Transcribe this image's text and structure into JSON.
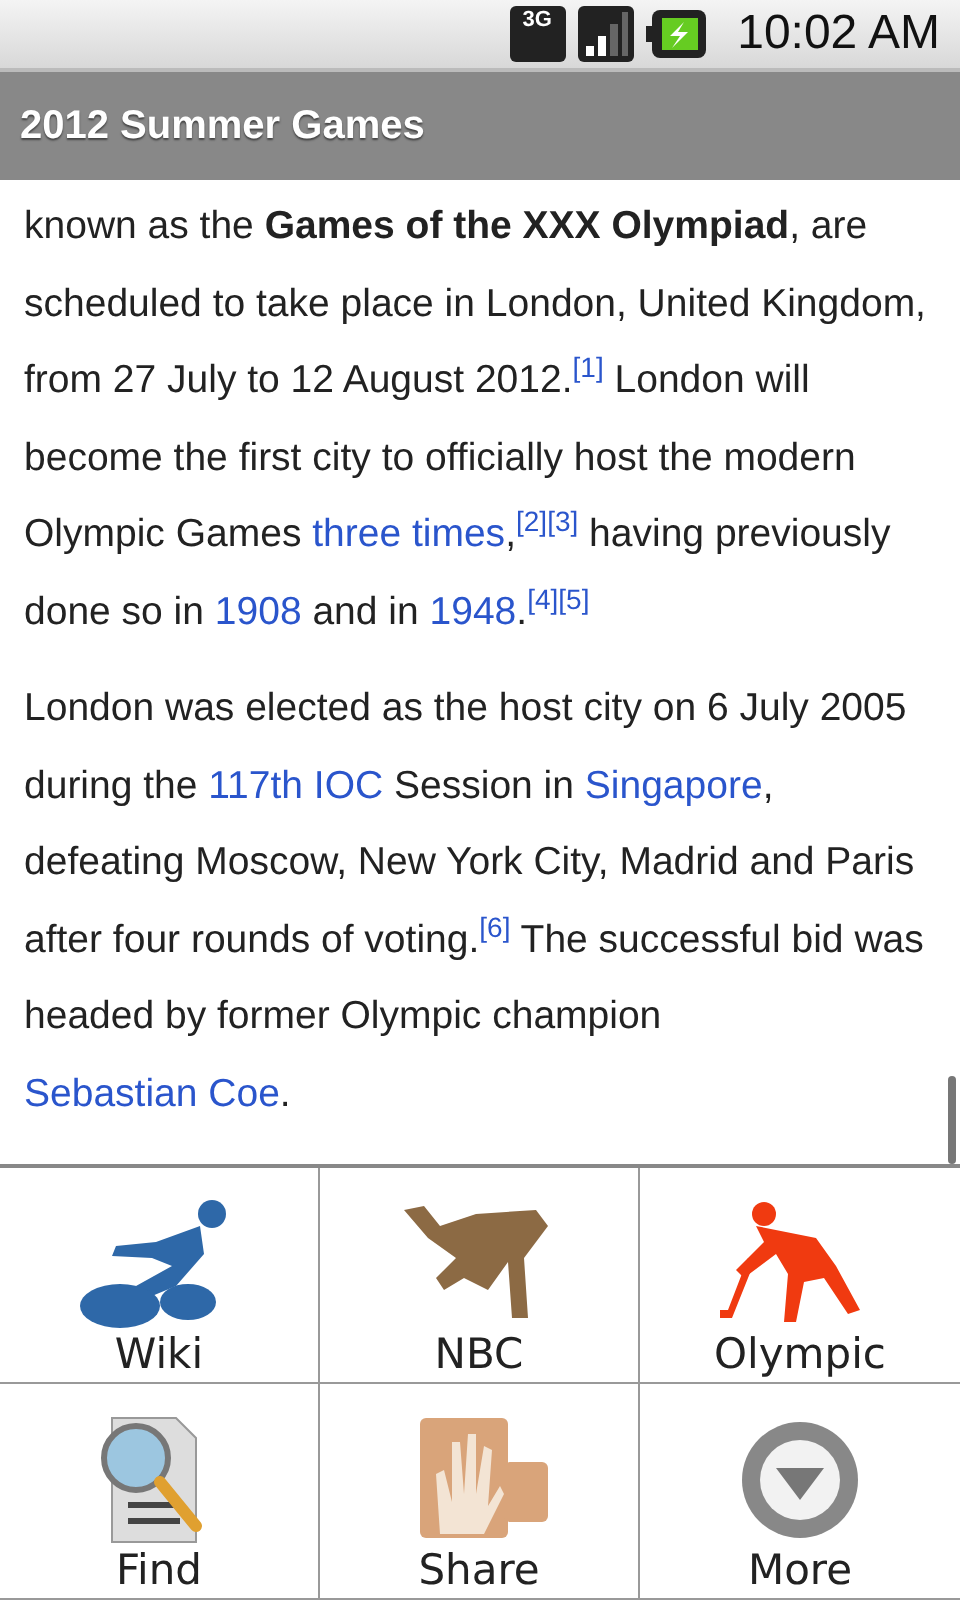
{
  "status_bar": {
    "network": "3G",
    "time": "10:02 AM"
  },
  "title_bar": {
    "title": "2012 Summer Games"
  },
  "article": {
    "paragraphs": [
      [
        {
          "kind": "text",
          "text": "known as the "
        },
        {
          "kind": "bold",
          "text": "Games of the XXX Olympiad"
        },
        {
          "kind": "text",
          "text": ", are scheduled to take place in London, United Kingdom, from 27 July to 12 August 2012."
        },
        {
          "kind": "ref",
          "text": "[1]"
        },
        {
          "kind": "text",
          "text": " London will become the first city to officially host the modern Olympic Games "
        },
        {
          "kind": "link",
          "text": "three times"
        },
        {
          "kind": "text",
          "text": ","
        },
        {
          "kind": "ref",
          "text": "[2]"
        },
        {
          "kind": "ref",
          "text": "[3]"
        },
        {
          "kind": "text",
          "text": " having previously done so in "
        },
        {
          "kind": "link",
          "text": "1908"
        },
        {
          "kind": "text",
          "text": " and in "
        },
        {
          "kind": "link",
          "text": "1948"
        },
        {
          "kind": "text",
          "text": "."
        },
        {
          "kind": "ref",
          "text": "[4]"
        },
        {
          "kind": "ref",
          "text": "[5]"
        }
      ],
      [
        {
          "kind": "text",
          "text": "London was elected as the host city on 6 July 2005 during the "
        },
        {
          "kind": "link",
          "text": "117th IOC"
        },
        {
          "kind": "text",
          "text": " Session in "
        },
        {
          "kind": "link",
          "text": "Singapore"
        },
        {
          "kind": "text",
          "text": ", defeating Moscow, New York City, Madrid and Paris after four rounds of voting."
        },
        {
          "kind": "ref",
          "text": "[6]"
        },
        {
          "kind": "text",
          "text": " The successful bid was headed by former Olympic champion "
        },
        {
          "kind": "link",
          "text": "Sebastian Coe"
        },
        {
          "kind": "text",
          "text": "."
        }
      ]
    ]
  },
  "menu": [
    {
      "label": "Wiki"
    },
    {
      "label": "NBC"
    },
    {
      "label": "Olympic"
    },
    {
      "label": "Find"
    },
    {
      "label": "Share"
    },
    {
      "label": "More"
    }
  ]
}
